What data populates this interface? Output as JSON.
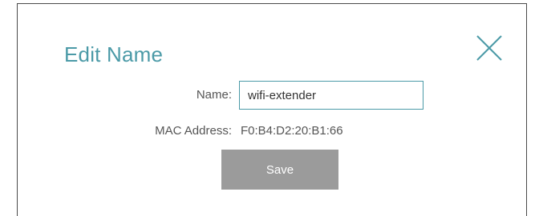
{
  "dialog": {
    "title": "Edit Name",
    "close_icon": "close-icon",
    "accent_color": "#4b9aa7"
  },
  "form": {
    "name_label": "Name:",
    "name_value": "wifi-extender",
    "mac_label": "MAC Address:",
    "mac_value": "F0:B4:D2:20:B1:66",
    "save_label": "Save",
    "save_color": "#9b9b9b"
  }
}
